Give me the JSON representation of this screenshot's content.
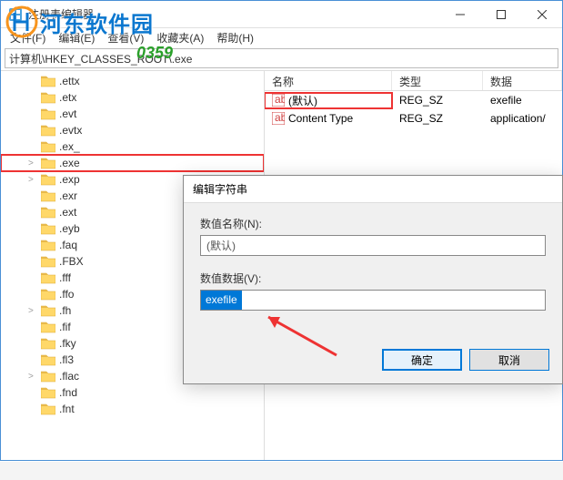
{
  "watermark": {
    "text": "河东软件园",
    "code": "0359"
  },
  "window": {
    "title": "注册表编辑器",
    "menu": {
      "file": "文件(F)",
      "edit": "编辑(E)",
      "view": "查看(V)",
      "fav": "收藏夹(A)",
      "help": "帮助(H)"
    },
    "address": "计算机\\HKEY_CLASSES_ROOT\\.exe"
  },
  "tree": {
    "items": [
      {
        "label": ".ettx",
        "exp": ""
      },
      {
        "label": ".etx",
        "exp": ""
      },
      {
        "label": ".evt",
        "exp": ""
      },
      {
        "label": ".evtx",
        "exp": ""
      },
      {
        "label": ".ex_",
        "exp": ""
      },
      {
        "label": ".exe",
        "exp": ">",
        "selected": true
      },
      {
        "label": ".exp",
        "exp": ">"
      },
      {
        "label": ".exr",
        "exp": ""
      },
      {
        "label": ".ext",
        "exp": ""
      },
      {
        "label": ".eyb",
        "exp": ""
      },
      {
        "label": ".faq",
        "exp": ""
      },
      {
        "label": ".FBX",
        "exp": ""
      },
      {
        "label": ".fff",
        "exp": ""
      },
      {
        "label": ".ffo",
        "exp": ""
      },
      {
        "label": ".fh",
        "exp": ">"
      },
      {
        "label": ".fif",
        "exp": ""
      },
      {
        "label": ".fky",
        "exp": ""
      },
      {
        "label": ".fl3",
        "exp": ""
      },
      {
        "label": ".flac",
        "exp": ">"
      },
      {
        "label": ".fnd",
        "exp": ""
      },
      {
        "label": ".fnt",
        "exp": ""
      }
    ]
  },
  "list": {
    "headers": {
      "name": "名称",
      "type": "类型",
      "data": "数据"
    },
    "rows": [
      {
        "name": "(默认)",
        "type": "REG_SZ",
        "data": "exefile",
        "highlighted": true
      },
      {
        "name": "Content Type",
        "type": "REG_SZ",
        "data": "application/"
      }
    ]
  },
  "dialog": {
    "title": "编辑字符串",
    "name_label": "数值名称(N):",
    "name_value": "(默认)",
    "data_label": "数值数据(V):",
    "data_value": "exefile",
    "ok": "确定",
    "cancel": "取消"
  }
}
